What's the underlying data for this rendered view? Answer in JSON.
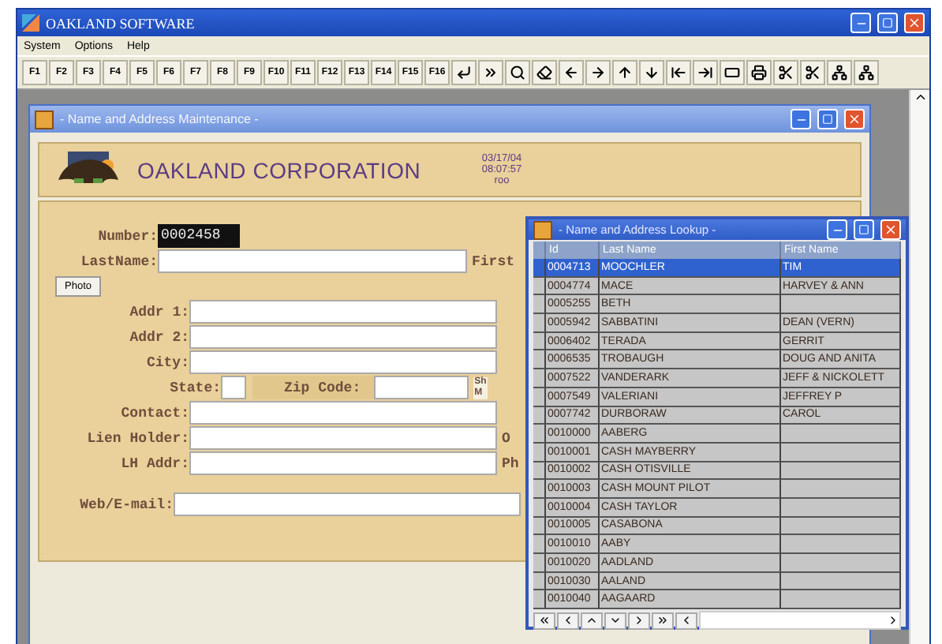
{
  "window": {
    "title": "OAKLAND SOFTWARE"
  },
  "menu": [
    "System",
    "Options",
    "Help"
  ],
  "function_keys": [
    "F1",
    "F2",
    "F3",
    "F4",
    "F5",
    "F6",
    "F7",
    "F8",
    "F9",
    "F10",
    "F11",
    "F12",
    "F13",
    "F14",
    "F15",
    "F16"
  ],
  "maintenance": {
    "title": "- Name and Address Maintenance -",
    "company": "OAKLAND CORPORATION",
    "date": "03/17/04",
    "time": "08:07:57",
    "user": "roo",
    "number": {
      "label": "Number:",
      "value": "0002458"
    },
    "last_name": {
      "label": "LastName:",
      "cut_label": "First"
    },
    "photo_button": "Photo",
    "address_fields": [
      {
        "label": "Addr 1:"
      },
      {
        "label": "Addr 2:"
      },
      {
        "label": "City:"
      }
    ],
    "state": {
      "label": "State:"
    },
    "zip": {
      "label": "Zip Code:"
    },
    "side_note": [
      "Sh",
      "M"
    ],
    "contact_fields": [
      {
        "label": "Contact:"
      },
      {
        "label": "Lien Holder:",
        "cut_label": "O"
      },
      {
        "label": "LH Addr:",
        "cut_label": "Ph"
      }
    ],
    "web": {
      "label": "Web/E-mail:"
    }
  },
  "lookup": {
    "title": "- Name and Address Lookup -",
    "columns": [
      "Id",
      "Last Name",
      "First Name"
    ],
    "rows": [
      {
        "id": "0004713",
        "last_name": "MOOCHLER",
        "first_name": "TIM",
        "selected": true
      },
      {
        "id": "0004774",
        "last_name": "MACE",
        "first_name": "HARVEY & ANN",
        "selected": false
      },
      {
        "id": "0005255",
        "last_name": "BETH",
        "first_name": "",
        "selected": false
      },
      {
        "id": "0005942",
        "last_name": "SABBATINI",
        "first_name": "DEAN (VERN)",
        "selected": false
      },
      {
        "id": "0006402",
        "last_name": "TERADA",
        "first_name": "GERRIT",
        "selected": false
      },
      {
        "id": "0006535",
        "last_name": "TROBAUGH",
        "first_name": "DOUG AND ANITA",
        "selected": false
      },
      {
        "id": "0007522",
        "last_name": "VANDERARK",
        "first_name": "JEFF & NICKOLETT",
        "selected": false
      },
      {
        "id": "0007549",
        "last_name": "VALERIANI",
        "first_name": "JEFFREY P",
        "selected": false
      },
      {
        "id": "0007742",
        "last_name": "DURBORAW",
        "first_name": "CAROL",
        "selected": false
      },
      {
        "id": "0010000",
        "last_name": "AABERG",
        "first_name": "",
        "selected": false
      },
      {
        "id": "0010001",
        "last_name": "CASH MAYBERRY",
        "first_name": "",
        "selected": false
      },
      {
        "id": "0010002",
        "last_name": "CASH OTISVILLE",
        "first_name": "",
        "selected": false
      },
      {
        "id": "0010003",
        "last_name": "CASH MOUNT PILOT",
        "first_name": "",
        "selected": false
      },
      {
        "id": "0010004",
        "last_name": "CASH TAYLOR",
        "first_name": "",
        "selected": false
      },
      {
        "id": "0010005",
        "last_name": "CASABONA",
        "first_name": "",
        "selected": false
      },
      {
        "id": "0010010",
        "last_name": "AABY",
        "first_name": "",
        "selected": false
      },
      {
        "id": "0010020",
        "last_name": "AADLAND",
        "first_name": "",
        "selected": false
      },
      {
        "id": "0010030",
        "last_name": "AALAND",
        "first_name": "",
        "selected": false
      },
      {
        "id": "0010040",
        "last_name": "AAGAARD",
        "first_name": "",
        "selected": false
      }
    ]
  }
}
